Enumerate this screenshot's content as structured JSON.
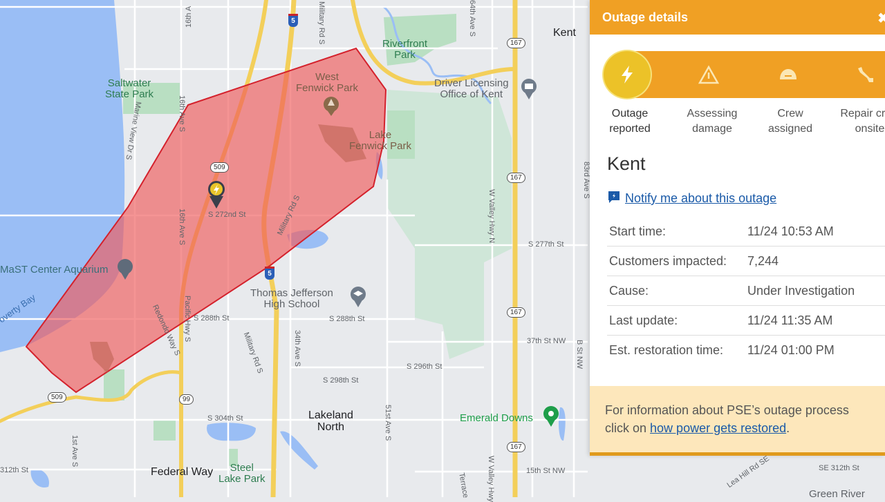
{
  "panel": {
    "title": "Outage details",
    "close_icon": "close-icon",
    "steps": [
      {
        "label_line1": "Outage",
        "label_line2": "reported",
        "icon": "lightning-bolt-icon",
        "active": true
      },
      {
        "label_line1": "Assessing",
        "label_line2": "damage",
        "icon": "warning-triangle-icon",
        "active": false
      },
      {
        "label_line1": "Crew",
        "label_line2": "assigned",
        "icon": "hard-hat-icon",
        "active": false
      },
      {
        "label_line1": "Repair crew",
        "label_line2": "onsite",
        "icon": "wrench-icon",
        "active": false
      }
    ],
    "area_name": "Kent",
    "notify_link": "Notify me about this outage",
    "details": [
      {
        "label": "Start time:",
        "value": "11/24 10:53 AM"
      },
      {
        "label": "Customers impacted:",
        "value": "7,244"
      },
      {
        "label": "Cause:",
        "value": "Under Investigation"
      },
      {
        "label": "Last update:",
        "value": "11/24 11:35 AM"
      },
      {
        "label": "Est. restoration time:",
        "value": "11/24 01:00 PM"
      }
    ],
    "info_text_1": "For information about PSE’s outage process",
    "info_text_2": "click on ",
    "info_link": "how power gets restored",
    "info_text_3": "."
  },
  "colors": {
    "accent_orange": "#f0a024",
    "active_step": "#ecc228",
    "outage_polygon": "#f05a5a",
    "link_blue": "#1a5aa8"
  },
  "map": {
    "labels": {
      "saltwater": "Saltwater\nState Park",
      "west_fenwick": "West\nFenwick Park",
      "lake_fenwick": "Lake\nFenwick Park",
      "riverfront": "Riverfront\nPark",
      "driver_licensing": "Driver Licensing\nOffice of Kent",
      "kent": "Kent",
      "mast": "MaST Center Aquarium",
      "poverty_bay": "overty Bay",
      "thomas_jefferson": "Thomas Jefferson\nHigh School",
      "lakeland": "Lakeland\nNorth",
      "emerald": "Emerald Downs",
      "federal_way": "Federal Way",
      "steel_lake": "Steel\nLake Park",
      "green_river": "Green River",
      "s272": "S 272nd St",
      "s277": "S 277th St",
      "s288a": "S 288th St",
      "s288b": "S 288th St",
      "s296": "S 296th St",
      "s298": "S 298th St",
      "s304": "S 304th St",
      "s312": "312th St",
      "se312": "SE 312th St",
      "st37": "37th St NW",
      "st15": "15th St NW",
      "ave16a": "16th Ave S",
      "ave16b": "16th Ave S",
      "ave16c": "16th A",
      "marine": "Marine View Dr S",
      "military1": "Military Rd S",
      "military2": "Military Rd S",
      "military3": "Military Rd S",
      "pacific": "Pacific Hwy S",
      "redondo": "Redondo Way S",
      "ave34a": "34th Ave S",
      "ave51": "51st Ave S",
      "ave1": "1st Ave S",
      "ave64": "64th Ave S",
      "ave83": "83rd Ave S",
      "wvalley1": "W Valley Hwy N",
      "wvalley2": "W Valley Hwy",
      "bst": "B St NW",
      "leahill": "Lea Hill Rd SE",
      "terrace": "Terrace"
    },
    "shields": {
      "sr509a": "509",
      "sr509b": "509",
      "sr167a": "167",
      "sr167b": "167",
      "sr167c": "167",
      "sr167d": "167",
      "sr99": "99",
      "i5a": "5",
      "i5b": "5"
    }
  }
}
